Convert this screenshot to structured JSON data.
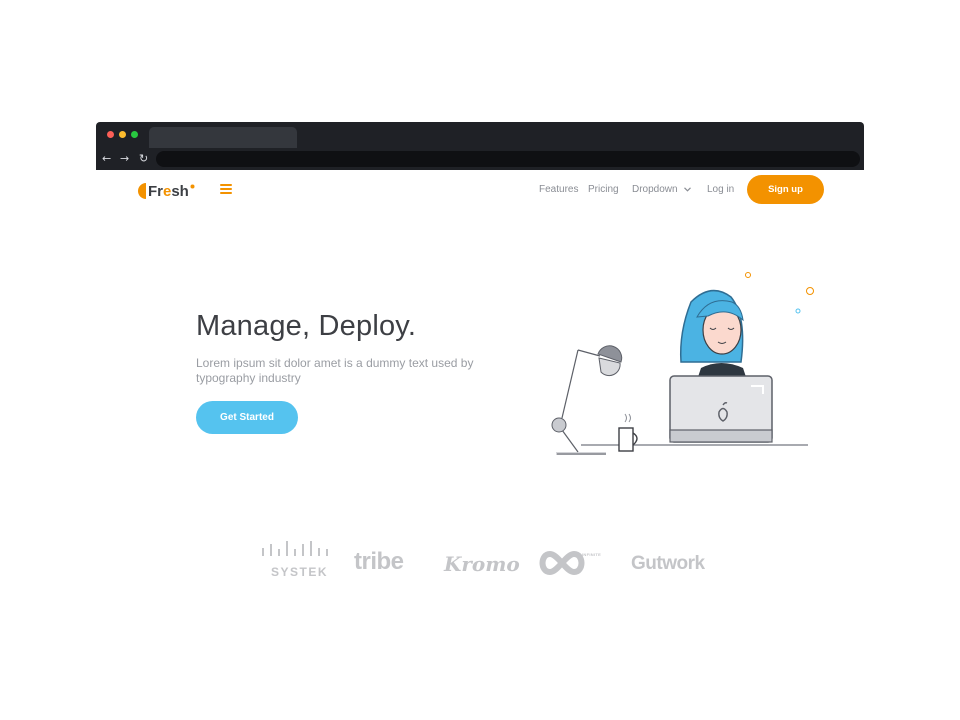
{
  "nav": {
    "logo_text_f": "Fr",
    "logo_text_e": "e",
    "logo_text_rest": "sh",
    "menu_icon": "hamburger-icon",
    "links": [
      {
        "label": "Features"
      },
      {
        "label": "Pricing"
      },
      {
        "label": "Dropdown"
      },
      {
        "label": "Log in"
      }
    ],
    "signup_label": "Sign up"
  },
  "hero": {
    "title": "Manage, Deploy.",
    "subtitle": "Lorem ipsum sit dolor amet is a dummy text used by typography industry",
    "cta_label": "Get Started"
  },
  "browser": {
    "back_icon": "←",
    "forward_icon": "→",
    "reload_icon": "↻"
  },
  "clients": [
    {
      "name": "SYSTEK"
    },
    {
      "name": "tribe"
    },
    {
      "name": "Kromo"
    },
    {
      "name": "INFINITE"
    },
    {
      "name": "Gutwork"
    }
  ],
  "colors": {
    "accent": "#f39200",
    "cta": "#55c3ef",
    "title": "#3d3f44",
    "brand_gray": "#c4c5c8"
  }
}
